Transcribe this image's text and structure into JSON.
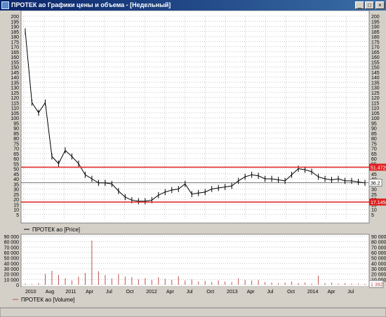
{
  "window": {
    "title": "ПРОТЕК ао Графики цены и объема - [Недельный]",
    "buttons": [
      "_",
      "□",
      "×"
    ]
  },
  "price_panel": {
    "legend": "ПРОТЕК ао [Price]",
    "y_ticks": [
      5,
      10,
      15,
      20,
      25,
      30,
      35,
      40,
      45,
      50,
      55,
      60,
      65,
      70,
      75,
      80,
      85,
      90,
      95,
      100,
      105,
      110,
      115,
      120,
      125,
      130,
      135,
      140,
      145,
      150,
      155,
      160,
      165,
      170,
      175,
      180,
      185,
      190,
      195,
      200
    ],
    "ylim": [
      0,
      200
    ],
    "levels": [
      {
        "label": "51.4720",
        "value": 51.472,
        "color": "#e02020"
      },
      {
        "label": "17.1450",
        "value": 17.145,
        "color": "#e02020"
      }
    ],
    "last_price": {
      "label": "36.2",
      "value": 36.2
    }
  },
  "volume_panel": {
    "legend": "ПРОТЕК ао [Volume]",
    "y_ticks": [
      "0",
      "10 000",
      "20 000",
      "30 000",
      "40 000",
      "50 000",
      "60 000",
      "70 000",
      "80 000",
      "90 000"
    ],
    "ylim": [
      0,
      90000
    ],
    "last_volume": {
      "label": "1 392",
      "value": 1392
    },
    "color": "#c05050"
  },
  "x_axis": {
    "labels": [
      "2010",
      "Aug",
      "2011",
      "Apr",
      "Jul",
      "Oct",
      "2012",
      "Apr",
      "Jul",
      "Oct",
      "2013",
      "Apr",
      "Jul",
      "Oct",
      "2014",
      "Apr",
      "Jul"
    ]
  },
  "chart_data": [
    {
      "type": "line",
      "x": [
        "2010-05",
        "2010-06",
        "2010-07",
        "2010-08",
        "2010-09",
        "2010-10",
        "2010-11",
        "2010-12",
        "2011-01",
        "2011-02",
        "2011-03",
        "2011-04",
        "2011-05",
        "2011-06",
        "2011-07",
        "2011-08",
        "2011-09",
        "2011-10",
        "2011-11",
        "2011-12",
        "2012-01",
        "2012-02",
        "2012-03",
        "2012-04",
        "2012-05",
        "2012-06",
        "2012-07",
        "2012-08",
        "2012-09",
        "2012-10",
        "2012-11",
        "2012-12",
        "2013-01",
        "2013-02",
        "2013-03",
        "2013-04",
        "2013-05",
        "2013-06",
        "2013-07",
        "2013-08",
        "2013-09",
        "2013-10",
        "2013-11",
        "2013-12",
        "2014-01",
        "2014-02",
        "2014-03",
        "2014-04",
        "2014-05",
        "2014-06",
        "2014-07",
        "2014-08"
      ],
      "series": [
        {
          "name": "ПРОТЕК ао [Price]",
          "values": [
            185,
            115,
            105,
            115,
            62,
            55,
            68,
            62,
            55,
            44,
            40,
            36,
            36,
            35,
            28,
            22,
            19,
            18,
            18,
            19,
            24,
            27,
            29,
            30,
            35,
            25,
            26,
            27,
            30,
            31,
            32,
            33,
            38,
            42,
            44,
            43,
            40,
            40,
            39,
            38,
            44,
            50,
            49,
            47,
            42,
            40,
            39,
            40,
            38,
            38,
            37,
            36
          ]
        }
      ],
      "ylim": [
        0,
        200
      ]
    },
    {
      "type": "bar",
      "x": [
        "2010-05",
        "2010-06",
        "2010-07",
        "2010-08",
        "2010-09",
        "2010-10",
        "2010-11",
        "2010-12",
        "2011-01",
        "2011-02",
        "2011-03",
        "2011-04",
        "2011-05",
        "2011-06",
        "2011-07",
        "2011-08",
        "2011-09",
        "2011-10",
        "2011-11",
        "2011-12",
        "2012-01",
        "2012-02",
        "2012-03",
        "2012-04",
        "2012-05",
        "2012-06",
        "2012-07",
        "2012-08",
        "2012-09",
        "2012-10",
        "2012-11",
        "2012-12",
        "2013-01",
        "2013-02",
        "2013-03",
        "2013-04",
        "2013-05",
        "2013-06",
        "2013-07",
        "2013-08",
        "2013-09",
        "2013-10",
        "2013-11",
        "2013-12",
        "2014-01",
        "2014-02",
        "2014-03",
        "2014-04",
        "2014-05",
        "2014-06",
        "2014-07",
        "2014-08"
      ],
      "series": [
        {
          "name": "ПРОТЕК ао [Volume]",
          "values": [
            2000,
            1500,
            3000,
            20000,
            26000,
            18000,
            12000,
            8000,
            15000,
            22000,
            82000,
            25000,
            18000,
            12000,
            20000,
            15000,
            14000,
            10000,
            12000,
            9000,
            14000,
            11000,
            9000,
            16000,
            8000,
            10000,
            6000,
            7000,
            5000,
            8000,
            6000,
            5000,
            12000,
            9000,
            8000,
            9000,
            5000,
            4000,
            3000,
            4000,
            6000,
            3000,
            4000,
            2000,
            17000,
            3000,
            4000,
            2000,
            3000,
            2000,
            2000,
            1392
          ]
        }
      ],
      "ylim": [
        0,
        90000
      ]
    }
  ]
}
